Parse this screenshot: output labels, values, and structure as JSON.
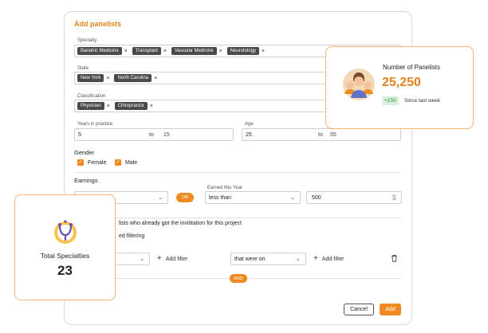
{
  "form": {
    "title": "Add panelists",
    "specialty": {
      "label": "Specialty",
      "chips": [
        "Bariatric Medicine",
        "Transplant",
        "Vascular Medicine",
        "Neurotology"
      ]
    },
    "state": {
      "label": "State",
      "chips": [
        "New York",
        "North Carolina"
      ]
    },
    "classification": {
      "label": "Classification",
      "chips": [
        "Physician",
        "Chiropractor"
      ]
    },
    "chip_remove": "×",
    "years": {
      "label": "Years in practice",
      "from": "5",
      "to_label": "to",
      "to": "15"
    },
    "age": {
      "label": "Age",
      "from": "25",
      "to_label": "to",
      "to": "55"
    },
    "gender": {
      "label": "Gender",
      "options": [
        "Female",
        "Male"
      ]
    },
    "earnings": {
      "label": "Earnings",
      "or_label": "OR",
      "earned_label": "Earned this Year",
      "comparator": "less than",
      "amount": "500",
      "currency": "$"
    },
    "exclude_text": "lists who already got the invititation for this project",
    "advanced_text": "ed filtering",
    "filter": {
      "add_filter": "Add filter",
      "right_select": "that were on",
      "and_label": "AND"
    },
    "buttons": {
      "cancel": "Cancel",
      "add": "Add"
    }
  },
  "panelists_card": {
    "title": "Number of Panelists",
    "value": "25,250",
    "badge": "+150",
    "since": "Since last week"
  },
  "specialties_card": {
    "title": "Total Specialties",
    "value": "23"
  },
  "colors": {
    "accent": "#ee8a1f",
    "accent_text": "#e3821c",
    "badge_bg": "#d8f1dc",
    "badge_text": "#2f8a45"
  }
}
